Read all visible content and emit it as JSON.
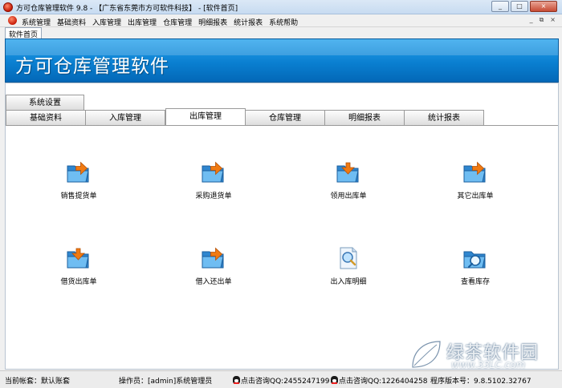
{
  "window": {
    "title": "方可仓库管理软件 9.8 - 【广东省东莞市方可软件科技】 - [软件首页]",
    "buttons": [
      "_",
      "□",
      "×"
    ]
  },
  "menubar": {
    "items": [
      "系统管理",
      "基础资料",
      "入库管理",
      "出库管理",
      "仓库管理",
      "明细报表",
      "统计报表",
      "系统帮助"
    ],
    "mdi_buttons": [
      "_",
      "⧉",
      "×"
    ]
  },
  "doc_tab": "软件首页",
  "banner": {
    "title": "方可仓库管理软件"
  },
  "tabs": {
    "row1": [
      "系统设置"
    ],
    "row2": [
      "基础资料",
      "入库管理",
      "出库管理",
      "仓库管理",
      "明细报表",
      "统计报表"
    ],
    "active": "出库管理"
  },
  "functions": [
    {
      "label": "销售提货单",
      "icon": "folder-arrow-icon"
    },
    {
      "label": "采购退货单",
      "icon": "folder-arrow-icon"
    },
    {
      "label": "领用出库单",
      "icon": "folder-arrow-icon"
    },
    {
      "label": "其它出库单",
      "icon": "folder-arrow-icon"
    },
    {
      "label": "借货出库单",
      "icon": "folder-arrow-icon"
    },
    {
      "label": "借入还出单",
      "icon": "folder-arrow-icon"
    },
    {
      "label": "出入库明细",
      "icon": "document-magnifier-icon"
    },
    {
      "label": "查看库存",
      "icon": "folder-magnifier-icon"
    }
  ],
  "status": {
    "account": "当前帐套：默认账套",
    "operator": "操作员：[admin]系统管理员",
    "qq1": "点击咨询QQ:2455247199",
    "qq2": "点击咨询QQ:1226404258",
    "version": "程序版本号：9.8.5102.32767"
  },
  "watermark": {
    "text": "绿茶软件园",
    "url": "www.33LC.com"
  },
  "colors": {
    "banner": "#0a7fd1",
    "accent_orange": "#f07a12",
    "folder_blue": "#4fa3e0"
  }
}
